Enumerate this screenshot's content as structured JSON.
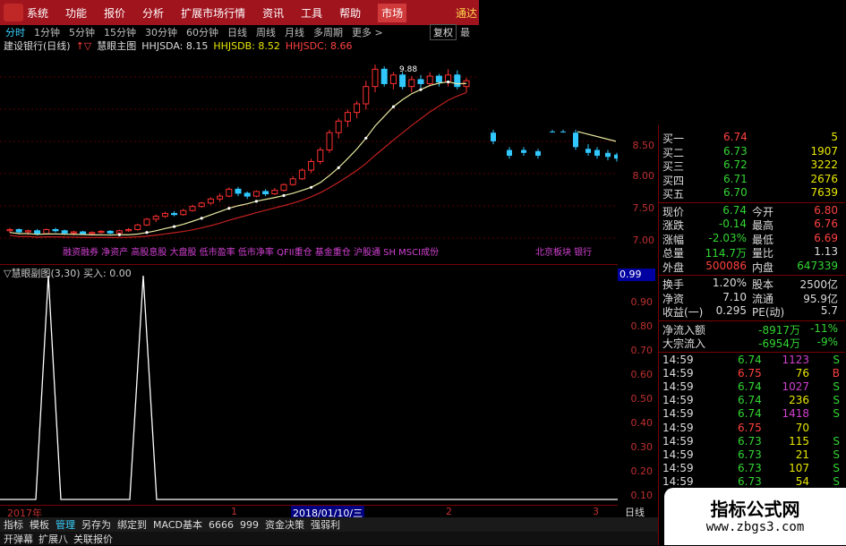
{
  "menu": {
    "items": [
      "系统",
      "功能",
      "报价",
      "分析",
      "扩展市场行情",
      "资讯",
      "工具",
      "帮助"
    ],
    "highlight": "市场",
    "right": "通达"
  },
  "periods": {
    "items": [
      "分时",
      "1分钟",
      "5分钟",
      "15分钟",
      "30分钟",
      "60分钟",
      "日线",
      "周线",
      "月线",
      "多周期",
      "更多 >"
    ],
    "active": "分时",
    "reright": "复权",
    "more": "最"
  },
  "infobar": {
    "stock": "建设银行(日线)",
    "indicator": "慧眼主图",
    "hhjsda": "HHJSDA: 8.15",
    "hhjsdb": "HHJSDB: 8.52",
    "hhjsdc": "HHJSDC: 8.66"
  },
  "chart_peak": "9.88",
  "sectors": "融资融券 净资产 高股息股 大盘股 低市盈率 低市净率 QFII重仓 基金重仓 沪股通 SH MSCI成份",
  "sector2": "北京板块 银行",
  "price_axis": [
    "8.50",
    "8.00",
    "7.50",
    "7.00"
  ],
  "indicator": {
    "label": "▽慧眼副图(3,30) 买入: 0.00",
    "current": "0.99"
  },
  "low_axis": [
    "0.90",
    "0.80",
    "0.70",
    "0.60",
    "0.50",
    "0.40",
    "0.30",
    "0.20",
    "0.10"
  ],
  "time_axis": {
    "year": "2017年",
    "sel": "2018/01/10/三",
    "m1": "1",
    "m2": "2",
    "m3": "3"
  },
  "day_label": "日线",
  "bottom_tabs": [
    "指标",
    "模板",
    "管理",
    "另存为",
    "绑定到",
    "MACD基本",
    "6666",
    "999",
    "资金决策",
    "强弱利"
  ],
  "bottom_active": "管理",
  "bottom_tabs2": [
    "开弹幕",
    "扩展八",
    "关联报价"
  ],
  "quote": {
    "bids": [
      {
        "label": "买一",
        "price": "6.74",
        "vol": "5"
      },
      {
        "label": "买二",
        "price": "6.73",
        "vol": "1907"
      },
      {
        "label": "买三",
        "price": "6.72",
        "vol": "3222"
      },
      {
        "label": "买四",
        "price": "6.71",
        "vol": "2676"
      },
      {
        "label": "买五",
        "price": "6.70",
        "vol": "7639"
      }
    ],
    "stats": [
      {
        "l1": "现价",
        "v1": "6.74",
        "l2": "今开",
        "v2": "6.80"
      },
      {
        "l1": "涨跌",
        "v1": "-0.14",
        "l2": "最高",
        "v2": "6.76"
      },
      {
        "l1": "涨幅",
        "v1": "-2.03%",
        "l2": "最低",
        "v2": "6.69"
      },
      {
        "l1": "总量",
        "v1": "114.7万",
        "l2": "量比",
        "v2": "1.13"
      },
      {
        "l1": "外盘",
        "v1": "500086",
        "l2": "内盘",
        "v2": "647339"
      }
    ],
    "stats2": [
      {
        "l1": "换手",
        "v1": "1.20%",
        "l2": "股本",
        "v2": "2500亿"
      },
      {
        "l1": "净资",
        "v1": "7.10",
        "l2": "流通",
        "v2": "95.9亿"
      },
      {
        "l1": "收益(一)",
        "v1": "0.295",
        "l2": "PE(动)",
        "v2": "5.7"
      }
    ],
    "flow": [
      {
        "l": "净流入额",
        "v": "-8917万",
        "p": "-11%"
      },
      {
        "l": "大宗流入",
        "v": "-6954万",
        "p": "-9%"
      }
    ],
    "ticks": [
      {
        "t": "14:59",
        "p": "6.74",
        "v": "1123",
        "s": "S"
      },
      {
        "t": "14:59",
        "p": "6.75",
        "v": "76",
        "s": "B"
      },
      {
        "t": "14:59",
        "p": "6.74",
        "v": "1027",
        "s": "S"
      },
      {
        "t": "14:59",
        "p": "6.74",
        "v": "236",
        "s": "S"
      },
      {
        "t": "14:59",
        "p": "6.74",
        "v": "1418",
        "s": "S"
      },
      {
        "t": "14:59",
        "p": "6.75",
        "v": "70",
        "s": ""
      },
      {
        "t": "14:59",
        "p": "6.73",
        "v": "115",
        "s": "S"
      },
      {
        "t": "14:59",
        "p": "6.73",
        "v": "21",
        "s": "S"
      },
      {
        "t": "14:59",
        "p": "6.73",
        "v": "107",
        "s": "S"
      },
      {
        "t": "14:59",
        "p": "6.73",
        "v": "54",
        "s": "S"
      }
    ]
  },
  "watermark": {
    "title": "指标公式网",
    "url": "www.zbgs3.com"
  }
}
